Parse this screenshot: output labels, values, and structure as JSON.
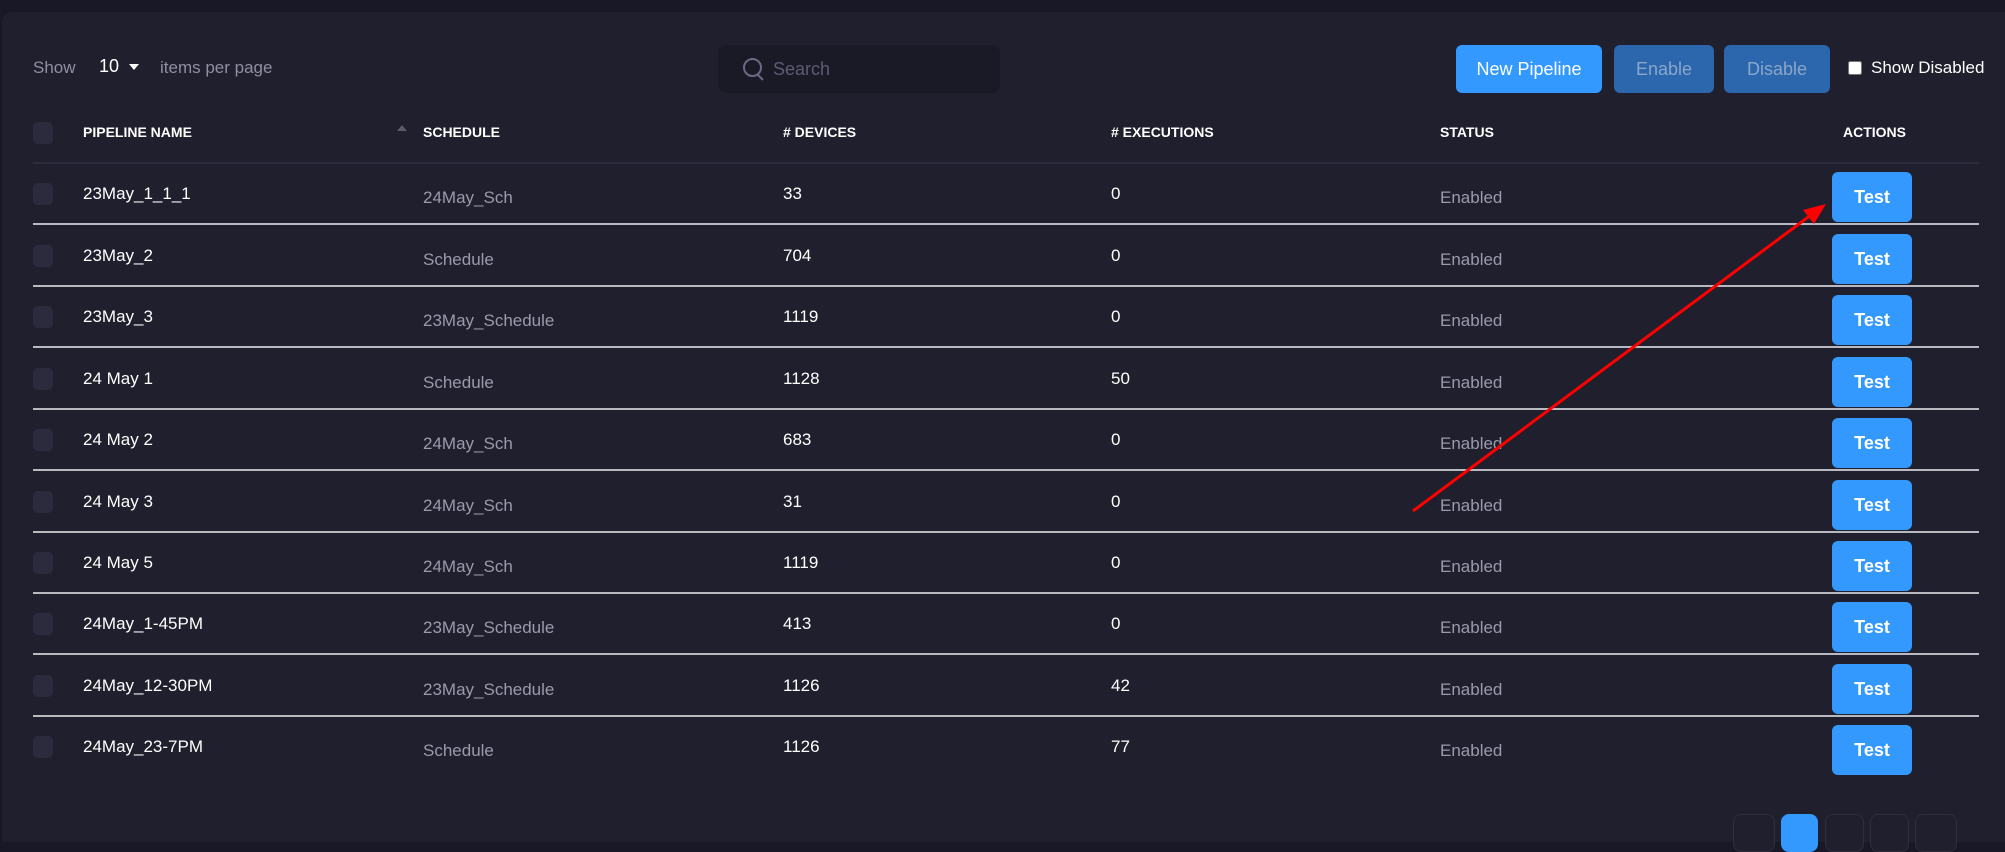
{
  "toolbar": {
    "show_label": "Show",
    "page_size": "10",
    "per_page_label": "items per page",
    "search_placeholder": "Search",
    "search_value": "",
    "new_pipeline_label": "New Pipeline",
    "enable_label": "Enable",
    "disable_label": "Disable",
    "show_disabled_label": "Show Disabled",
    "show_disabled_checked": false
  },
  "table": {
    "columns": [
      "PIPELINE NAME",
      "SCHEDULE",
      "# DEVICES",
      "# EXECUTIONS",
      "STATUS",
      "ACTIONS"
    ],
    "sort": {
      "column": "PIPELINE NAME",
      "direction": "ascending"
    },
    "rows": [
      {
        "name": "23May_1_1_1",
        "schedule": "24May_Sch",
        "devices": "33",
        "executions": "0",
        "status": "Enabled",
        "action": "Test"
      },
      {
        "name": "23May_2",
        "schedule": "Schedule",
        "devices": "704",
        "executions": "0",
        "status": "Enabled",
        "action": "Test"
      },
      {
        "name": "23May_3",
        "schedule": "23May_Schedule",
        "devices": "1119",
        "executions": "0",
        "status": "Enabled",
        "action": "Test"
      },
      {
        "name": "24 May 1",
        "schedule": "Schedule",
        "devices": "1128",
        "executions": "50",
        "status": "Enabled",
        "action": "Test"
      },
      {
        "name": "24 May 2",
        "schedule": "24May_Sch",
        "devices": "683",
        "executions": "0",
        "status": "Enabled",
        "action": "Test"
      },
      {
        "name": "24 May 3",
        "schedule": "24May_Sch",
        "devices": "31",
        "executions": "0",
        "status": "Enabled",
        "action": "Test"
      },
      {
        "name": "24 May 5",
        "schedule": "24May_Sch",
        "devices": "1119",
        "executions": "0",
        "status": "Enabled",
        "action": "Test"
      },
      {
        "name": "24May_1-45PM",
        "schedule": "23May_Schedule",
        "devices": "413",
        "executions": "0",
        "status": "Enabled",
        "action": "Test"
      },
      {
        "name": "24May_12-30PM",
        "schedule": "23May_Schedule",
        "devices": "1126",
        "executions": "42",
        "status": "Enabled",
        "action": "Test"
      },
      {
        "name": "24May_23-7PM",
        "schedule": "Schedule",
        "devices": "1126",
        "executions": "77",
        "status": "Enabled",
        "action": "Test"
      }
    ]
  },
  "pagination": {
    "active_index": 1,
    "button_count": 5
  },
  "annotation": {
    "type": "arrow",
    "color": "#ff0000",
    "points_to": "Test button of first row"
  },
  "colors": {
    "accent": "#3399ff",
    "disabled_button": "#2c66ad",
    "background": "#1f1f2d"
  }
}
